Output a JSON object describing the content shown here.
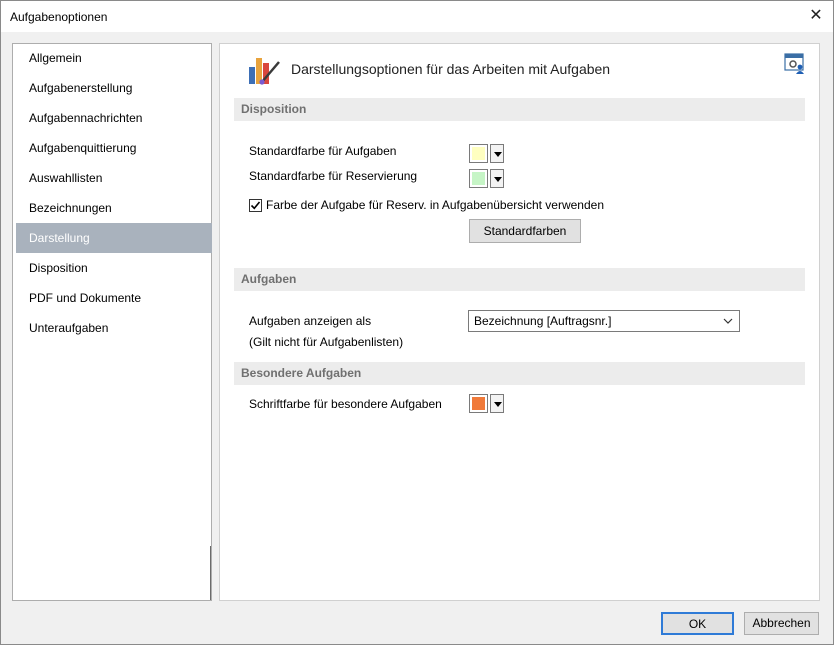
{
  "window": {
    "title": "Aufgabenoptionen",
    "close_glyph": "✕"
  },
  "sidebar": {
    "items": [
      {
        "label": "Allgemein"
      },
      {
        "label": "Aufgabenerstellung"
      },
      {
        "label": "Aufgabennachrichten"
      },
      {
        "label": "Aufgabenquittierung"
      },
      {
        "label": "Auswahllisten"
      },
      {
        "label": "Bezeichnungen"
      },
      {
        "label": "Darstellung",
        "selected": true
      },
      {
        "label": "Disposition"
      },
      {
        "label": "PDF und Dokumente"
      },
      {
        "label": "Unteraufgaben"
      }
    ]
  },
  "content": {
    "header_title": "Darstellungsoptionen für das Arbeiten mit Aufgaben",
    "header_icon": "palette-chart-icon",
    "corner_icon": "user-settings-icon",
    "disposition": {
      "heading": "Disposition",
      "task_color_label": "Standardfarbe für Aufgaben",
      "task_color": "#ffffc0",
      "reservation_color_label": "Standardfarbe für Reservierung",
      "reservation_color": "#c6f5c6",
      "use_task_color_label": "Farbe der Aufgabe für Reserv. in Aufgabenübersicht verwenden",
      "use_task_color_checked": true,
      "default_colors_button": "Standardfarben"
    },
    "tasks": {
      "heading": "Aufgaben",
      "display_as_label": "Aufgaben anzeigen als",
      "display_as_note": "(Gilt nicht für Aufgabenlisten)",
      "display_as_value": "Bezeichnung [Auftragsnr.]"
    },
    "special": {
      "heading": "Besondere Aufgaben",
      "font_color_label": "Schriftfarbe für besondere Aufgaben",
      "font_color": "#f07a3a"
    }
  },
  "footer": {
    "ok_label": "OK",
    "cancel_label": "Abbrechen"
  },
  "colors": {
    "selection": "#a9b2bd",
    "focus_border": "#2f7bd7"
  }
}
